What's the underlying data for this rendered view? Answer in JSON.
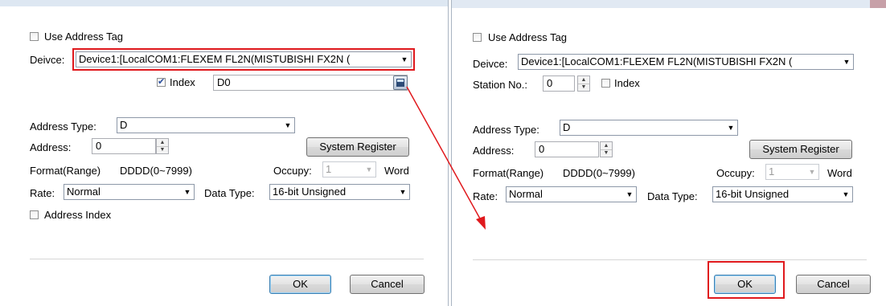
{
  "left_dialog": {
    "use_address_tag_label": "Use Address Tag",
    "device_label": "Deivce:",
    "device_value": "Device1:[LocalCOM1:FLEXEM FL2N(MISTUBISHI FX2N (",
    "index_label": "Index",
    "index_checked": true,
    "index_value": "D0",
    "address_type_label": "Address Type:",
    "address_type_value": "D",
    "address_label": "Address:",
    "address_value": "0",
    "system_register_label": "System Register",
    "format_label": "Format(Range)",
    "format_value": "DDDD(0~7999)",
    "occupy_label": "Occupy:",
    "occupy_value": "1",
    "occupy_unit": "Word",
    "rate_label": "Rate:",
    "rate_value": "Normal",
    "data_type_label": "Data Type:",
    "data_type_value": "16-bit Unsigned",
    "address_index_label": "Address Index",
    "ok_label": "OK",
    "cancel_label": "Cancel"
  },
  "right_dialog": {
    "use_address_tag_label": "Use Address Tag",
    "device_label": "Deivce:",
    "device_value": "Device1:[LocalCOM1:FLEXEM FL2N(MISTUBISHI FX2N (",
    "station_label": "Station No.:",
    "station_value": "0",
    "index_label": "Index",
    "index_checked": false,
    "address_type_label": "Address Type:",
    "address_type_value": "D",
    "address_label": "Address:",
    "address_value": "0",
    "system_register_label": "System Register",
    "format_label": "Format(Range)",
    "format_value": "DDDD(0~7999)",
    "occupy_label": "Occupy:",
    "occupy_value": "1",
    "occupy_unit": "Word",
    "rate_label": "Rate:",
    "rate_value": "Normal",
    "data_type_label": "Data Type:",
    "data_type_value": "16-bit Unsigned",
    "ok_label": "OK",
    "cancel_label": "Cancel"
  },
  "icons": {
    "checkmark": "check-icon",
    "dropdown": "chevron-down-icon",
    "spinner": "spin-arrows-icon",
    "calculator": "calculator-icon",
    "annotation_arrow": "red-arrow-icon"
  },
  "colors": {
    "highlight_red": "#e0191d",
    "divider": "#a9b4c2"
  }
}
